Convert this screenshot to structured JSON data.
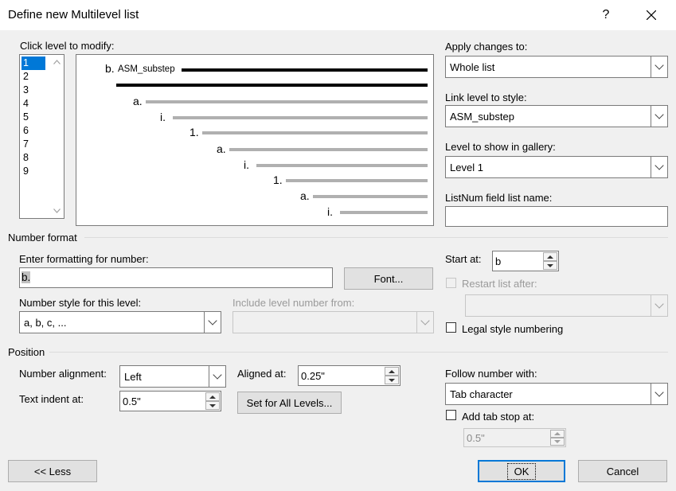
{
  "window": {
    "title": "Define new Multilevel list",
    "help_label": "?",
    "close_label": "✕"
  },
  "levels": {
    "label": "Click level to modify:",
    "items": [
      "1",
      "2",
      "3",
      "4",
      "5",
      "6",
      "7",
      "8",
      "9"
    ],
    "selected": "1"
  },
  "preview": {
    "numbers": [
      "b.",
      "a.",
      "i.",
      "1.",
      "a.",
      "i.",
      "1.",
      "a.",
      "i."
    ],
    "style_label": "ASM_substep"
  },
  "apply": {
    "label": "Apply changes to:",
    "value": "Whole list"
  },
  "link_style": {
    "label": "Link level to style:",
    "value": "ASM_substep"
  },
  "gallery": {
    "label": "Level to show in gallery:",
    "value": "Level 1"
  },
  "listnum": {
    "label": "ListNum field list name:",
    "value": ""
  },
  "number_format": {
    "section": "Number format",
    "enter_label": "Enter formatting for number:",
    "format_value": "b.",
    "font_button": "Font...",
    "style_label": "Number style for this level:",
    "style_value": "a, b, c, ...",
    "include_label": "Include level number from:",
    "include_value": "",
    "start_label": "Start at:",
    "start_value": "b",
    "restart_label": "Restart list after:",
    "restart_value": "",
    "legal_label": "Legal style numbering"
  },
  "position": {
    "section": "Position",
    "alignment_label": "Number alignment:",
    "alignment_value": "Left",
    "aligned_label": "Aligned at:",
    "aligned_value": "0.25\"",
    "indent_label": "Text indent at:",
    "indent_value": "0.5\"",
    "set_all_button": "Set for All Levels...",
    "follow_label": "Follow number with:",
    "follow_value": "Tab character",
    "tabstop_label": "Add tab stop at:",
    "tabstop_value": "0.5\""
  },
  "footer": {
    "less_button": "<< Less",
    "ok_button": "OK",
    "cancel_button": "Cancel"
  }
}
